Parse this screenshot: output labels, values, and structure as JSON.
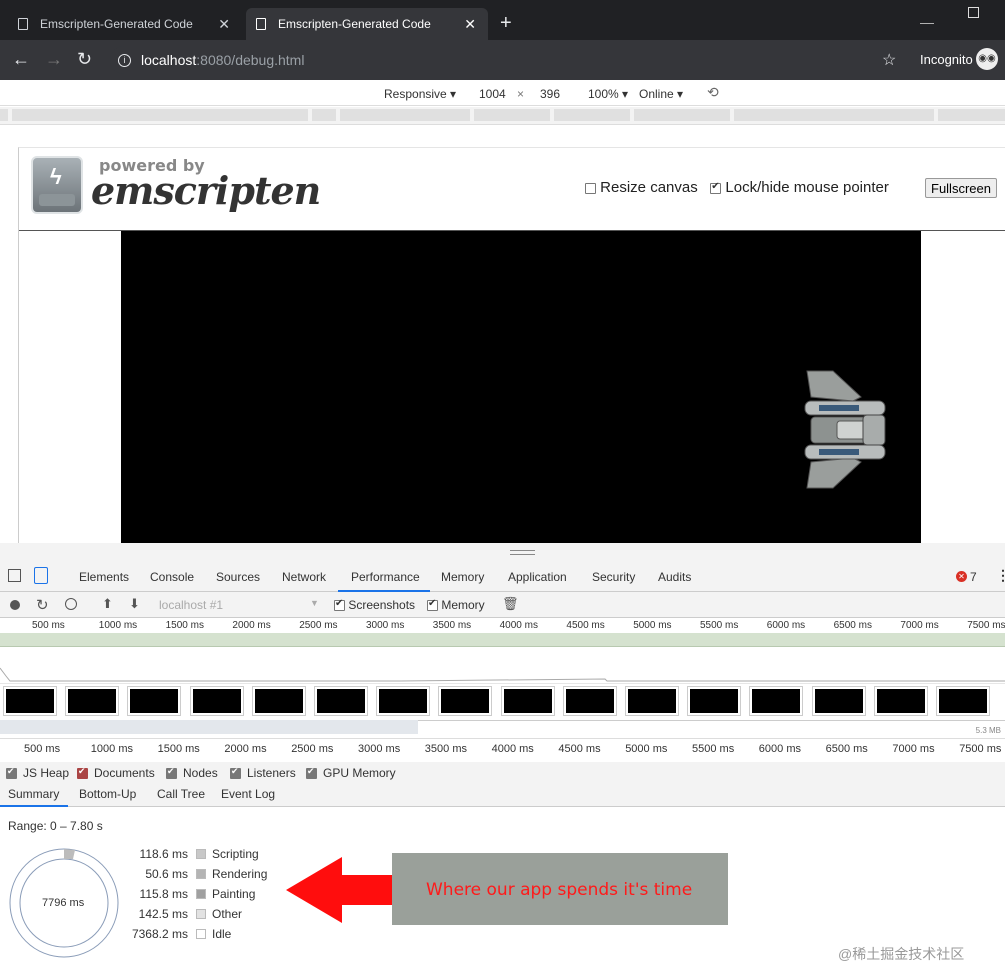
{
  "browser": {
    "tabs": [
      {
        "title": "Emscripten-Generated Code"
      },
      {
        "title": "Emscripten-Generated Code"
      }
    ],
    "new_tab": "+",
    "url_host": "localhost",
    "url_rest": ":8080/debug.html",
    "profile": "Incognito"
  },
  "device_toolbar": {
    "mode": "Responsive",
    "width": "1004",
    "times": "×",
    "height": "396",
    "zoom": "100%",
    "network": "Online"
  },
  "page": {
    "powered_by": "powered by",
    "brand": "emscripten",
    "resize_canvas_label": "Resize canvas",
    "resize_canvas_checked": false,
    "lock_pointer_label": "Lock/hide mouse pointer",
    "lock_pointer_checked": true,
    "fullscreen_label": "Fullscreen"
  },
  "devtools": {
    "tabs": [
      "Elements",
      "Console",
      "Sources",
      "Network",
      "Performance",
      "Memory",
      "Application",
      "Security",
      "Audits"
    ],
    "active_tab": "Performance",
    "error_count": "7",
    "target": "localhost #1",
    "screenshots_label": "Screenshots",
    "memory_label": "Memory",
    "ticks": [
      "500 ms",
      "1000 ms",
      "1500 ms",
      "2000 ms",
      "2500 ms",
      "3000 ms",
      "3500 ms",
      "4000 ms",
      "4500 ms",
      "5000 ms",
      "5500 ms",
      "6000 ms",
      "6500 ms",
      "7000 ms",
      "7500 ms"
    ],
    "heap_size": "5.3 MB",
    "counters": [
      "JS Heap",
      "Documents",
      "Nodes",
      "Listeners",
      "GPU Memory"
    ],
    "bottom_tabs": [
      "Summary",
      "Bottom-Up",
      "Call Tree",
      "Event Log"
    ],
    "range": "Range: 0 – 7.80 s",
    "total": "7796 ms",
    "summary_rows": [
      {
        "ms": "118.6 ms",
        "name": "Scripting",
        "color": "#c8c8c8"
      },
      {
        "ms": "50.6 ms",
        "name": "Rendering",
        "color": "#b4b4b4"
      },
      {
        "ms": "115.8 ms",
        "name": "Painting",
        "color": "#a0a0a0"
      },
      {
        "ms": "142.5 ms",
        "name": "Other",
        "color": "#e2e2e2"
      },
      {
        "ms": "7368.2 ms",
        "name": "Idle",
        "color": "#ffffff"
      }
    ]
  },
  "annotation": "Where our app spends it's time",
  "watermark": "@稀土掘金技术社区"
}
